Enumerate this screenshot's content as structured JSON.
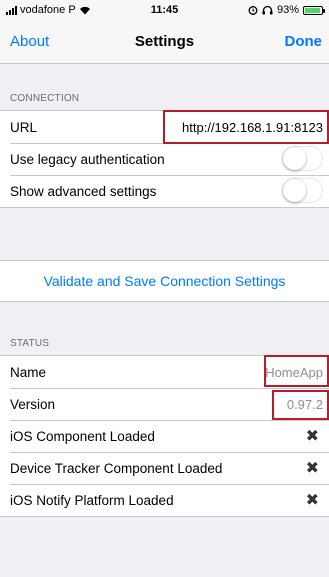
{
  "status_bar": {
    "carrier": "vodafone P",
    "time": "11:45",
    "battery": "93%",
    "battery_level": 0.93,
    "icons": [
      "signal-bars-icon",
      "wifi-icon",
      "alarm-icon",
      "headphones-icon",
      "battery-icon"
    ]
  },
  "nav": {
    "left": "About",
    "title": "Settings",
    "right": "Done",
    "accent": "#007aff"
  },
  "connection": {
    "header": "CONNECTION",
    "url_label": "URL",
    "url_value": "http://192.168.1.91:8123",
    "legacy_label": "Use legacy authentication",
    "legacy_on": false,
    "advanced_label": "Show advanced settings",
    "advanced_on": false
  },
  "validate_label": "Validate and Save Connection Settings",
  "status": {
    "header": "STATUS",
    "name_label": "Name",
    "name_value": "HomeApp",
    "version_label": "Version",
    "version_value": "0.97.2",
    "components": [
      {
        "label": "iOS Component Loaded",
        "mark": "✖"
      },
      {
        "label": "Device Tracker Component Loaded",
        "mark": "✖"
      },
      {
        "label": "iOS Notify Platform Loaded",
        "mark": "✖"
      }
    ]
  },
  "highlight_color": "#b71c2b"
}
